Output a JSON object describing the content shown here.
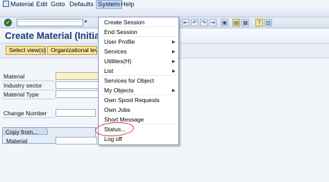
{
  "menu": [
    "Material",
    "Edit",
    "Goto",
    "Defaults",
    "System",
    "Help"
  ],
  "toolbar": {
    "command_value": ""
  },
  "title": "Create Material (Initial",
  "app_buttons": [
    "Select view(s)",
    "Organizational level"
  ],
  "form": {
    "material_label": "Material",
    "industry_sector_label": "Industry sector",
    "material_type_label": "Material Type",
    "change_number_label": "Change Number",
    "copy_from_label": "Copy from...",
    "copy_material_label": "Material"
  },
  "system_menu": [
    {
      "label": "Create Session",
      "submenu": false
    },
    {
      "label": "End Session",
      "submenu": false
    },
    {
      "label": "User Profile",
      "submenu": true
    },
    {
      "label": "Services",
      "submenu": true
    },
    {
      "label": "Utilities(H)",
      "submenu": true
    },
    {
      "label": "List",
      "submenu": true
    },
    {
      "label": "Services for Object",
      "submenu": false
    },
    {
      "label": "My Objects",
      "submenu": true
    },
    {
      "label": "Own Spool Requests",
      "submenu": false
    },
    {
      "label": "Own Jobs",
      "submenu": false
    },
    {
      "label": "Short Message",
      "submenu": false
    },
    {
      "label": "Status...",
      "submenu": false
    },
    {
      "label": "Log off",
      "submenu": false
    }
  ],
  "highlight_color": "#e03030"
}
